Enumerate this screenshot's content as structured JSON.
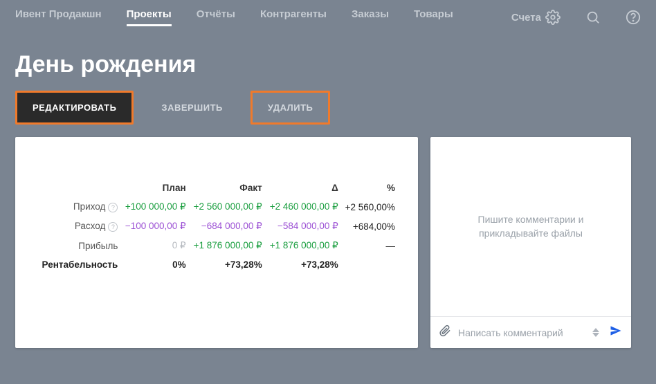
{
  "nav": {
    "items": [
      {
        "label": "Ивент Продакшн",
        "active": false
      },
      {
        "label": "Проекты",
        "active": true
      },
      {
        "label": "Отчёты",
        "active": false
      },
      {
        "label": "Контрагенты",
        "active": false
      },
      {
        "label": "Заказы",
        "active": false
      },
      {
        "label": "Товары",
        "active": false
      }
    ],
    "accounts_label": "Счета"
  },
  "page": {
    "title": "День рождения"
  },
  "actions": {
    "edit": "РЕДАКТИРОВАТЬ",
    "finish": "ЗАВЕРШИТЬ",
    "delete": "УДАЛИТЬ"
  },
  "table": {
    "headers": {
      "plan": "План",
      "fact": "Факт",
      "delta": "Δ",
      "percent": "%"
    },
    "rows": {
      "income": {
        "label": "Приход",
        "plan": "+100 000,00 ₽",
        "fact": "+2 560 000,00 ₽",
        "delta": "+2 460 000,00 ₽",
        "percent": "+2 560,00%"
      },
      "expense": {
        "label": "Расход",
        "plan": "−100 000,00 ₽",
        "fact": "−684 000,00 ₽",
        "delta": "−584 000,00 ₽",
        "percent": "+684,00%"
      },
      "profit": {
        "label": "Прибыль",
        "plan": "0 ₽",
        "fact": "+1 876 000,00 ₽",
        "delta": "+1 876 000,00 ₽",
        "percent": "—"
      },
      "margin": {
        "label": "Рентабельность",
        "plan": "0%",
        "fact": "+73,28%",
        "delta": "+73,28%",
        "percent": ""
      }
    }
  },
  "comments": {
    "placeholder_text": "Пишите комментарии и прикладывайте файлы",
    "input_placeholder": "Написать комментарий"
  }
}
